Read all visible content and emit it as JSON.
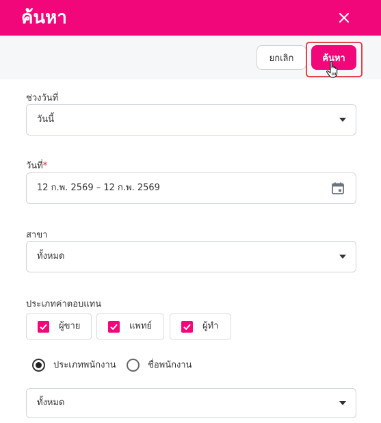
{
  "header": {
    "title": "ค้นหา"
  },
  "toolbar": {
    "cancel_label": "ยกเลิก",
    "search_label": "ค้นหา"
  },
  "form": {
    "date_range": {
      "label": "ช่วงวันที่",
      "value": "วันนี้"
    },
    "date": {
      "label": "วันที่",
      "required_mark": "*",
      "value": "12 ก.พ. 2569 – 12 ก.พ. 2569"
    },
    "branch": {
      "label": "สาขา",
      "value": "ทั้งหมด"
    },
    "commission_type": {
      "label": "ประเภทค่าตอบแทน",
      "options": [
        {
          "label": "ผู้ขาย",
          "checked": true
        },
        {
          "label": "แพทย์",
          "checked": true
        },
        {
          "label": "ผู้ทำ",
          "checked": true
        }
      ]
    },
    "employee_filter": {
      "options": [
        {
          "label": "ประเภทพนักงาน",
          "selected": true
        },
        {
          "label": "ชื่อพนักงาน",
          "selected": false
        }
      ],
      "value": "ทั้งหมด"
    }
  },
  "icons": {
    "close": "close-icon",
    "calendar": "calendar-icon",
    "dropdown": "chevron-down-icon",
    "check": "check-icon",
    "cursor": "hand-pointer-icon"
  },
  "colors": {
    "accent": "#f2077a",
    "focus_outline": "#e0454c",
    "required": "#e0243b"
  }
}
